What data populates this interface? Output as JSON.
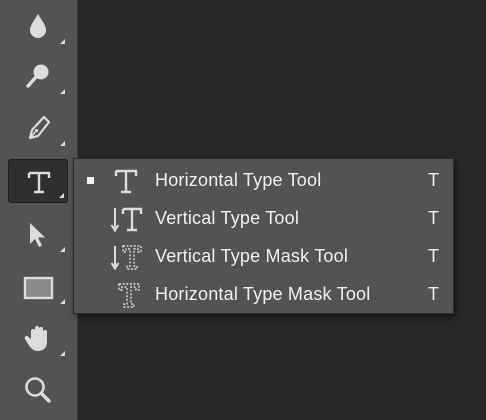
{
  "toolbar": {
    "tools": [
      {
        "icon": "blur-drop-icon"
      },
      {
        "icon": "dodge-icon"
      },
      {
        "icon": "pen-icon"
      },
      {
        "icon": "type-icon",
        "active": true
      },
      {
        "icon": "path-selection-icon"
      },
      {
        "icon": "rectangle-icon"
      },
      {
        "icon": "hand-icon"
      },
      {
        "icon": "zoom-icon"
      }
    ]
  },
  "flyout": {
    "items": [
      {
        "label": "Horizontal Type Tool",
        "shortcut": "T",
        "icon": "horizontal-type-icon",
        "selected": true
      },
      {
        "label": "Vertical Type Tool",
        "shortcut": "T",
        "icon": "vertical-type-icon",
        "selected": false
      },
      {
        "label": "Vertical Type Mask Tool",
        "shortcut": "T",
        "icon": "vertical-type-mask-icon",
        "selected": false
      },
      {
        "label": "Horizontal Type Mask Tool",
        "shortcut": "T",
        "icon": "horizontal-type-mask-icon",
        "selected": false
      }
    ]
  },
  "colors": {
    "panel": "#535353",
    "canvas": "#282828",
    "icon": "#dcdcdc",
    "text": "#f0f0f0"
  }
}
